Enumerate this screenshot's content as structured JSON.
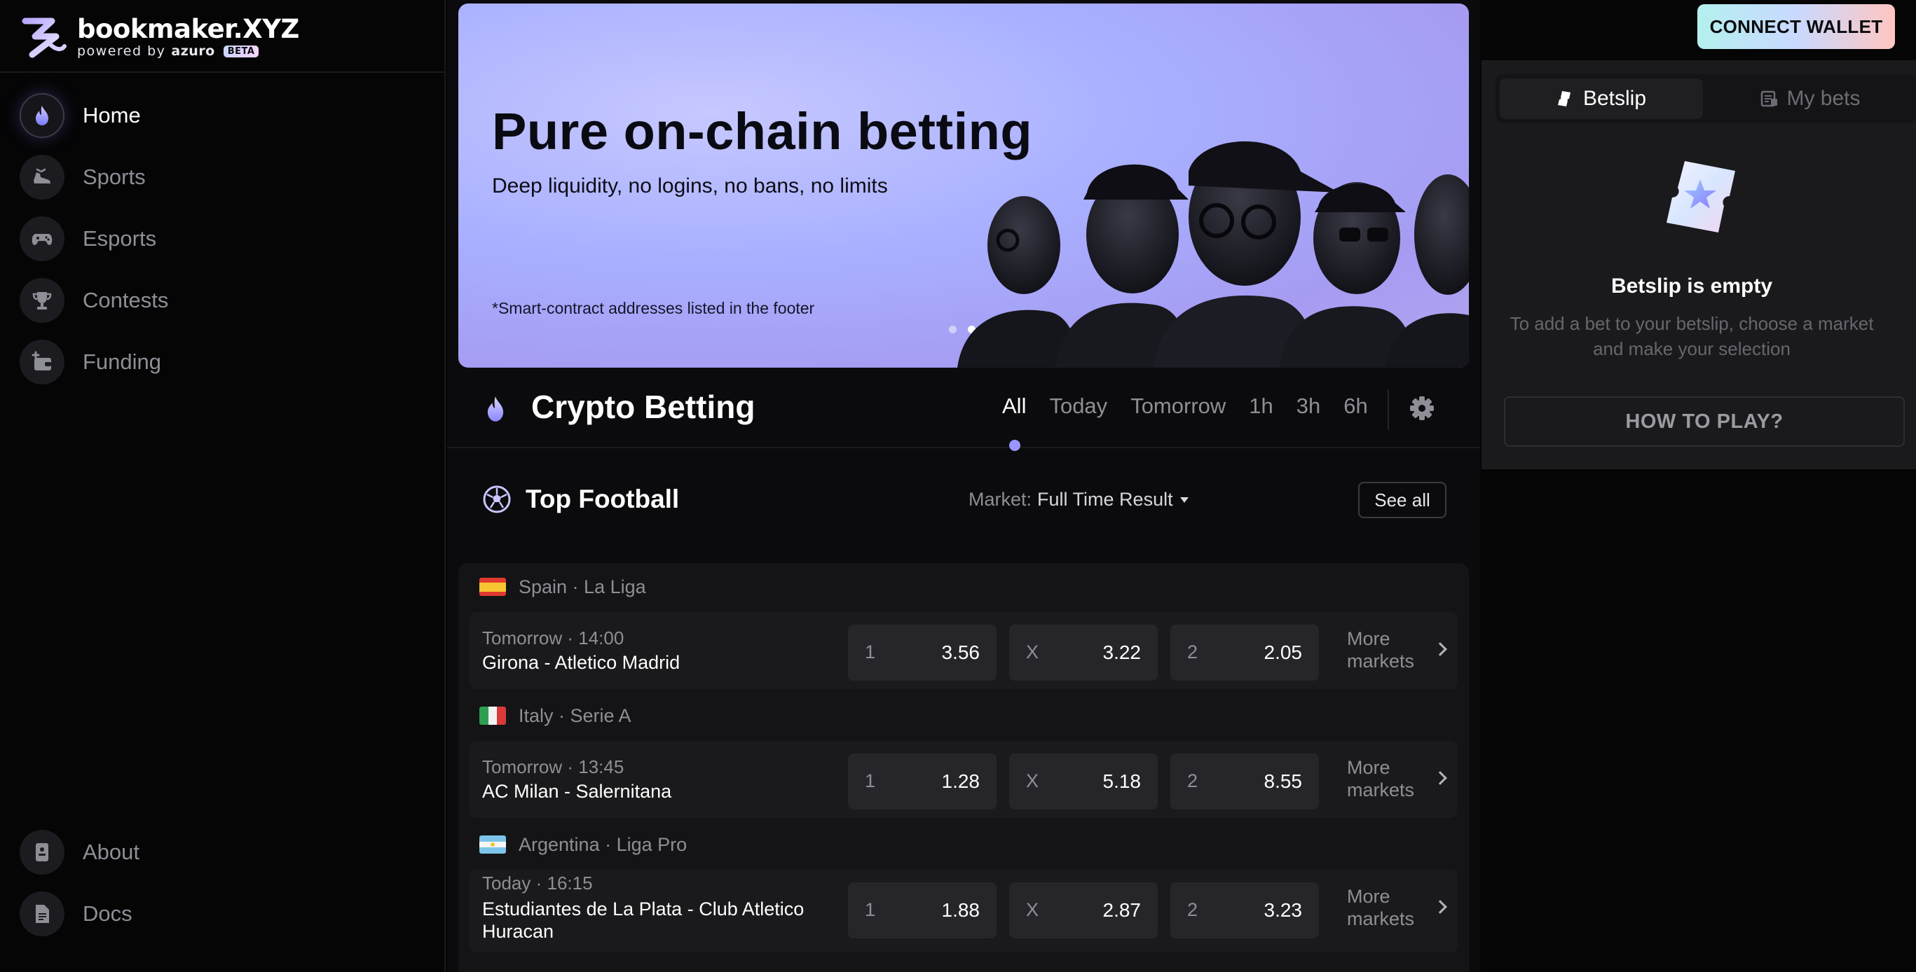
{
  "brand": {
    "name": "bookmaker.XYZ",
    "powered": "powered by",
    "partner": "azuro",
    "badge": "BETA"
  },
  "sidebar": {
    "items": [
      {
        "label": "Home",
        "icon": "flame-icon",
        "active": true
      },
      {
        "label": "Sports",
        "icon": "sneaker-icon"
      },
      {
        "label": "Esports",
        "icon": "gamepad-icon"
      },
      {
        "label": "Contests",
        "icon": "trophy-icon"
      },
      {
        "label": "Funding",
        "icon": "wallet-plus-icon"
      }
    ],
    "footer": [
      {
        "label": "About",
        "icon": "info-card-icon"
      },
      {
        "label": "Docs",
        "icon": "document-icon"
      }
    ]
  },
  "hero": {
    "title": "Pure on-chain betting",
    "subtitle": "Deep liquidity, no logins, no bans, no limits",
    "note": "*Smart-contract addresses listed in the footer",
    "slides": 2,
    "active_slide": 2
  },
  "section": {
    "title": "Crypto Betting",
    "filters": [
      "All",
      "Today",
      "Tomorrow",
      "1h",
      "3h",
      "6h"
    ],
    "active_filter": "All"
  },
  "top_football": {
    "title": "Top Football",
    "market_label": "Market:",
    "market_value": "Full Time Result",
    "see_all": "See all",
    "more_markets": "More markets",
    "leagues": [
      {
        "name": "Spain · La Liga",
        "flag": "spain",
        "game": {
          "time": "Tomorrow · 14:00",
          "teams": "Girona - Atletico Madrid",
          "odds": [
            {
              "k": "1",
              "v": "3.56"
            },
            {
              "k": "X",
              "v": "3.22"
            },
            {
              "k": "2",
              "v": "2.05"
            }
          ]
        }
      },
      {
        "name": "Italy · Serie A",
        "flag": "italy",
        "game": {
          "time": "Tomorrow · 13:45",
          "teams": "AC Milan - Salernitana",
          "odds": [
            {
              "k": "1",
              "v": "1.28"
            },
            {
              "k": "X",
              "v": "5.18"
            },
            {
              "k": "2",
              "v": "8.55"
            }
          ]
        }
      },
      {
        "name": "Argentina · Liga Pro",
        "flag": "argentina",
        "game": {
          "time": "Today · 16:15",
          "teams": "Estudiantes de La Plata - Club Atletico Huracan",
          "odds": [
            {
              "k": "1",
              "v": "1.88"
            },
            {
              "k": "X",
              "v": "2.87"
            },
            {
              "k": "2",
              "v": "3.23"
            }
          ]
        }
      }
    ]
  },
  "right": {
    "connect": "CONNECT WALLET",
    "tabs": [
      {
        "label": "Betslip",
        "active": true
      },
      {
        "label": "My bets"
      }
    ],
    "empty_title": "Betslip is empty",
    "empty_desc": "To add a bet to your betslip, choose a market and make your selection",
    "how_to_play": "HOW TO PLAY?"
  },
  "colors": {
    "accent": "#9a96ff",
    "background": "#050506",
    "panel": "#1a1a1c",
    "hero_gradient": [
      "#c6c8ff",
      "#a59cf2"
    ]
  }
}
